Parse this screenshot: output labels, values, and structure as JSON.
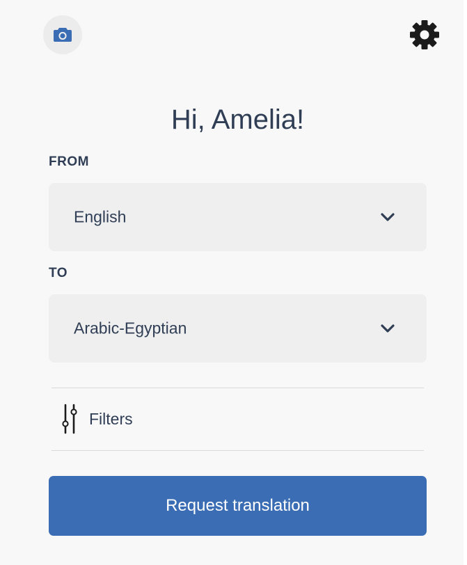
{
  "header": {
    "camera_icon": "camera-icon",
    "settings_icon": "gear-icon"
  },
  "greeting": "Hi, Amelia!",
  "from": {
    "label": "FROM",
    "selected": "English"
  },
  "to": {
    "label": "TO",
    "selected": "Arabic-Egyptian"
  },
  "filters": {
    "label": "Filters",
    "icon": "sliders-icon"
  },
  "actions": {
    "request_label": "Request translation"
  },
  "colors": {
    "accent": "#3a6db3",
    "text": "#2f3e55",
    "field_bg": "#efefef",
    "background": "#f8f8f8"
  }
}
